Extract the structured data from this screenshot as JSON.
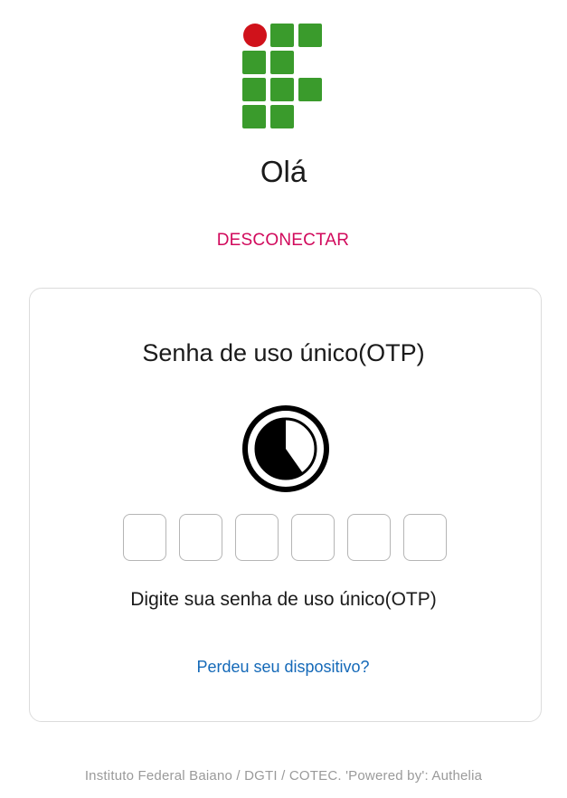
{
  "header": {
    "logo_icon": "ifbaiano-logo-icon",
    "greeting": "Olá",
    "logout_label": "DESCONECTAR"
  },
  "card": {
    "title": "Senha de uso único(OTP)",
    "timer_icon": "countdown-timer-icon",
    "otp_digits": [
      "",
      "",
      "",
      "",
      "",
      ""
    ],
    "hint": "Digite sua senha de uso único(OTP)",
    "lost_device_link": "Perdeu seu dispositivo?"
  },
  "footer": {
    "text": "Instituto Federal Baiano / DGTI / COTEC. 'Powered by': Authelia"
  },
  "colors": {
    "logo_green": "#3a9b2c",
    "logo_red": "#d0121b",
    "logout": "#d10a5c",
    "link": "#1469b8",
    "footer": "#9a9a9a"
  }
}
